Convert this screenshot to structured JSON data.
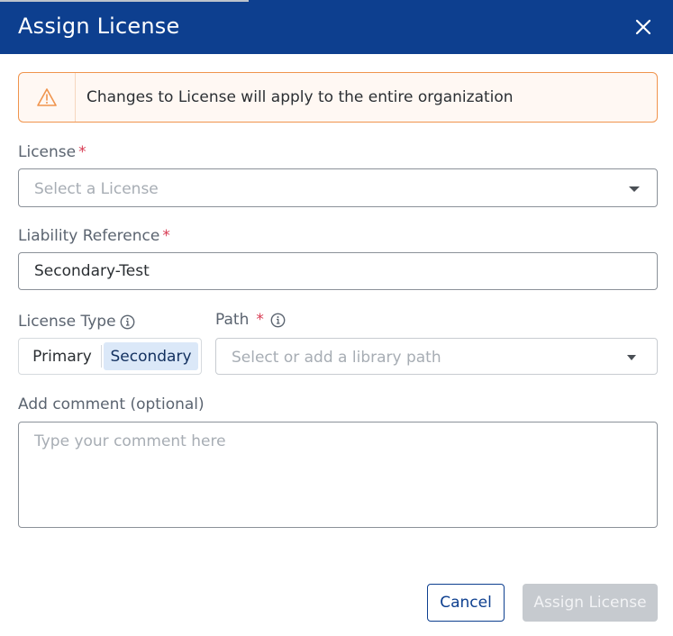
{
  "dialog": {
    "title": "Assign License",
    "close_icon": "close-icon"
  },
  "alert": {
    "icon": "warning-icon",
    "message": "Changes to License will apply to the entire organization",
    "border_color": "#f0944d"
  },
  "license": {
    "label": "License",
    "required_mark": "*",
    "placeholder": "Select a License"
  },
  "liability": {
    "label": "Liability Reference",
    "required_mark": "*",
    "value": "Secondary-Test"
  },
  "license_type": {
    "label": "License Type",
    "options": [
      "Primary",
      "Secondary"
    ],
    "selected": "Secondary"
  },
  "path": {
    "label": "Path",
    "required_mark": "*",
    "placeholder": "Select or add a library path"
  },
  "comment": {
    "label": "Add comment (optional)",
    "placeholder": "Type your comment here"
  },
  "footer": {
    "cancel_label": "Cancel",
    "submit_label": "Assign License"
  },
  "colors": {
    "header": "#0d3f8f",
    "required": "#d83a52",
    "selected_toggle": "#dbe8f8",
    "disabled_button": "#c6cacf"
  }
}
